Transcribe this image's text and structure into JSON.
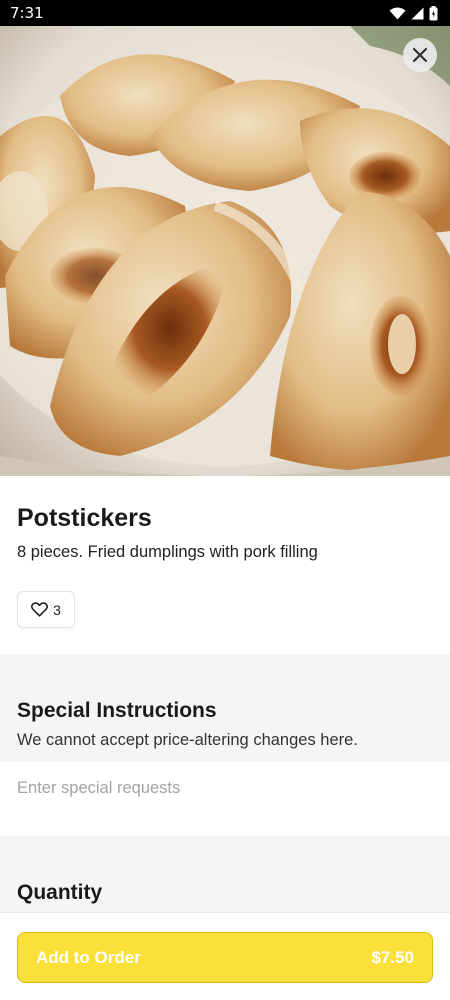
{
  "status_bar": {
    "time": "7:31",
    "icons": [
      "wifi-icon",
      "signal-icon",
      "battery-icon"
    ]
  },
  "hero": {
    "image": "potstickers-photo",
    "close_icon": "close-icon"
  },
  "item": {
    "name": "Potstickers",
    "description": "8 pieces. Fried dumplings with pork filling",
    "likes": "3",
    "like_icon": "heart-icon"
  },
  "special_instructions": {
    "title": "Special Instructions",
    "subtitle": "We cannot accept price-altering changes here.",
    "placeholder": "Enter special requests",
    "value": ""
  },
  "quantity": {
    "title": "Quantity"
  },
  "order_button": {
    "label": "Add to Order",
    "price": "$7.50",
    "color": "#fbe03a"
  }
}
